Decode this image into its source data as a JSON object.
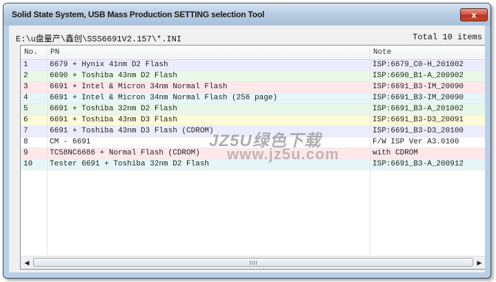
{
  "window": {
    "title": "Solid State System, USB Mass Production SETTING selection Tool",
    "close_symbol": "x"
  },
  "path_text": "E:\\u盘量产\\鑫创\\SSS6691V2.157\\*.INI",
  "total_text": "Total 10 items",
  "columns": {
    "no": "No.",
    "pn": "PN",
    "note": "Note"
  },
  "rows": [
    {
      "no": "1",
      "pn": "6679 + Hynix 41nm D2 Flash",
      "note": "ISP:6679_C0-H_201002",
      "color": "#ececff"
    },
    {
      "no": "2",
      "pn": "6690 + Toshiba 43nm D2 Flash",
      "note": "ISP:6690_B1-A_200902",
      "color": "#e9f9e9"
    },
    {
      "no": "3",
      "pn": "6691 + Intel & Micron 34nm Normal Flash",
      "note": "ISP:6691_B3-IM_20090",
      "color": "#ffe8ea"
    },
    {
      "no": "4",
      "pn": "6691 + Intel & Micron 34nm Normal Flash (256 page)",
      "note": "ISP:6691_B3-IM_20090",
      "color": "#e6f6f8"
    },
    {
      "no": "5",
      "pn": "6691 + Toshiba 32nm D2 Flash",
      "note": "ISP:6691_B3-A_201002",
      "color": "#e8f8e8"
    },
    {
      "no": "6",
      "pn": "6691 + Toshiba 43nm D3 Flash",
      "note": "ISP:6691_B3-D3_20091",
      "color": "#fdfbd8"
    },
    {
      "no": "7",
      "pn": "6691 + Toshiba 43nm D3 Flash (CDROM)",
      "note": "ISP:6691_B3-D3_20100",
      "color": "#ececff"
    },
    {
      "no": "8",
      "pn": "CM - 6691",
      "note": "F/W ISP Ver A3.0100",
      "color": "#ffffff"
    },
    {
      "no": "9",
      "pn": "TC58NC6686 + Normal Flash (CDROM)",
      "note": "with CDROM",
      "color": "#ffe8ea"
    },
    {
      "no": "10",
      "pn": "Tester 6691 + Toshiba 32nm D2 Flash",
      "note": "ISP:6691_B3-A_200912",
      "color": "#e6f6f8"
    }
  ],
  "watermark": {
    "line1": "JZ5U绿色下载",
    "line2": "www.jz5u.com"
  },
  "colors": {
    "title_bar": "#b9cde3",
    "close_button": "#cf4d3a",
    "frame": "#b9cfe6"
  }
}
